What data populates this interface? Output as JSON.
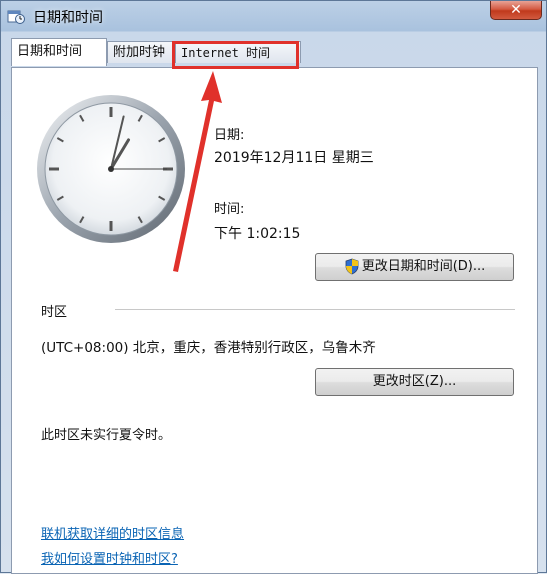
{
  "window": {
    "title": "日期和时间",
    "close_label": "✕"
  },
  "tabs": [
    {
      "label": "日期和时间"
    },
    {
      "label": "附加时钟"
    },
    {
      "label": "Internet 时间"
    }
  ],
  "date_section": {
    "date_heading": "日期:",
    "date_value": "2019年12月11日 星期三",
    "time_heading": "时间:",
    "time_value": "下午 1:02:15"
  },
  "buttons": {
    "change_datetime": "更改日期和时间(D)...",
    "change_timezone": "更改时区(Z)..."
  },
  "timezone": {
    "heading": "时区",
    "value": "(UTC+08:00) 北京，重庆，香港特别行政区，乌鲁木齐",
    "dst_note": "此时区未实行夏令时。"
  },
  "links": {
    "online_info": "联机获取详细的时区信息",
    "how_to_set": "我如何设置时钟和时区?"
  },
  "annotation": {
    "highlight_color": "#e0312b"
  },
  "clock": {
    "hour": 1,
    "minute": 2,
    "second": 15
  }
}
